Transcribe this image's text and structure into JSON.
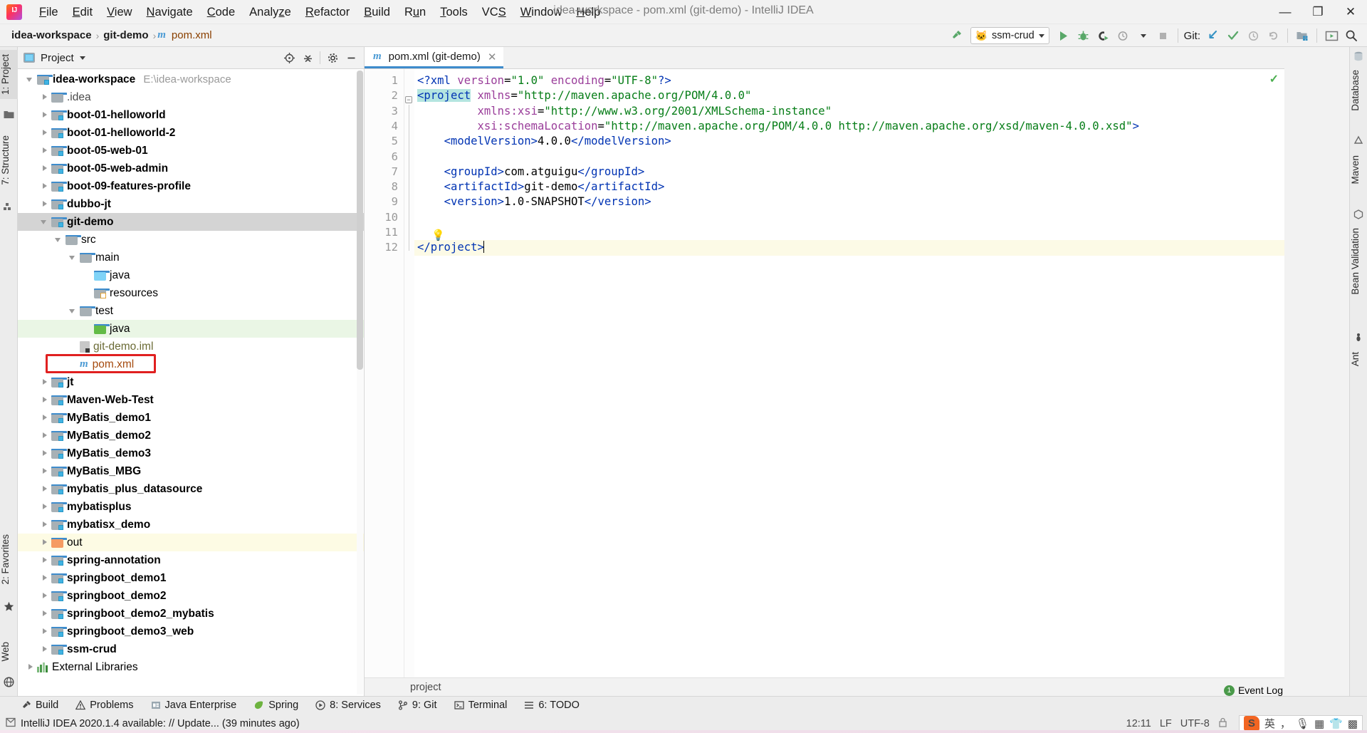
{
  "window": {
    "title": "idea-workspace - pom.xml (git-demo) - IntelliJ IDEA",
    "minimize": "—",
    "maximize": "❐",
    "close": "✕",
    "logo_text": "IJ"
  },
  "menu": [
    {
      "label": "File",
      "mnemonic": "F"
    },
    {
      "label": "Edit",
      "mnemonic": "E"
    },
    {
      "label": "View",
      "mnemonic": "V"
    },
    {
      "label": "Navigate",
      "mnemonic": "N"
    },
    {
      "label": "Code",
      "mnemonic": "C"
    },
    {
      "label": "Analyze",
      "mnemonic": "z"
    },
    {
      "label": "Refactor",
      "mnemonic": "R"
    },
    {
      "label": "Build",
      "mnemonic": "B"
    },
    {
      "label": "Run",
      "mnemonic": "u"
    },
    {
      "label": "Tools",
      "mnemonic": "T"
    },
    {
      "label": "VCS",
      "mnemonic": "S"
    },
    {
      "label": "Window",
      "mnemonic": "W"
    },
    {
      "label": "Help",
      "mnemonic": "H"
    }
  ],
  "navbar": {
    "crumbs": [
      "idea-workspace",
      "git-demo",
      "pom.xml"
    ],
    "separator": "›",
    "run_config": "ssm-crud",
    "git_label": "Git:",
    "icons": {
      "build": "hammer-icon",
      "run": "run-icon",
      "debug": "debug-icon",
      "run_coverage": "run-with-coverage-icon",
      "profiler": "profiler-icon",
      "stop": "stop-icon",
      "update_project": "git-update-icon",
      "commit": "git-commit-icon",
      "history": "git-history-icon",
      "rollback": "git-rollback-icon",
      "project_structure": "project-structure-icon",
      "presentation": "presentation-icon",
      "search": "search-icon"
    }
  },
  "left_strip": [
    {
      "label": "1: Project",
      "selected": true
    },
    {
      "label": "7: Structure",
      "selected": false
    },
    {
      "label": "2: Favorites",
      "selected": false
    },
    {
      "label": "Web",
      "selected": false
    }
  ],
  "right_strip": [
    {
      "label": "Database"
    },
    {
      "label": "Maven"
    },
    {
      "label": "Bean Validation"
    },
    {
      "label": "Ant"
    }
  ],
  "project_panel": {
    "title": "Project",
    "dropdown_caret": "▾",
    "icons": [
      "locate-icon",
      "collapse-all-icon",
      "settings-gear-icon",
      "hide-icon"
    ],
    "tree": [
      {
        "depth": 0,
        "label": "idea-workspace",
        "hint": "E:\\idea-workspace",
        "arrow": "down",
        "icon": "module-folder",
        "bold": true
      },
      {
        "depth": 1,
        "label": ".idea",
        "arrow": "right",
        "icon": "folder-plain",
        "bold": false,
        "dim": true
      },
      {
        "depth": 1,
        "label": "boot-01-helloworld",
        "arrow": "right",
        "icon": "module-folder",
        "bold": true
      },
      {
        "depth": 1,
        "label": "boot-01-helloworld-2",
        "arrow": "right",
        "icon": "module-folder",
        "bold": true
      },
      {
        "depth": 1,
        "label": "boot-05-web-01",
        "arrow": "right",
        "icon": "module-folder",
        "bold": true
      },
      {
        "depth": 1,
        "label": "boot-05-web-admin",
        "arrow": "right",
        "icon": "module-folder",
        "bold": true
      },
      {
        "depth": 1,
        "label": "boot-09-features-profile",
        "arrow": "right",
        "icon": "module-folder",
        "bold": true
      },
      {
        "depth": 1,
        "label": "dubbo-jt",
        "arrow": "right",
        "icon": "module-folder",
        "bold": true
      },
      {
        "depth": 1,
        "label": "git-demo",
        "arrow": "down",
        "icon": "module-folder",
        "bold": true,
        "selected": true
      },
      {
        "depth": 2,
        "label": "src",
        "arrow": "down",
        "icon": "folder-plain",
        "bold": false
      },
      {
        "depth": 3,
        "label": "main",
        "arrow": "down",
        "icon": "folder-plain",
        "bold": false
      },
      {
        "depth": 4,
        "label": "java",
        "arrow": "none",
        "icon": "folder-blue",
        "bold": false
      },
      {
        "depth": 4,
        "label": "resources",
        "arrow": "none",
        "icon": "folder-resources",
        "bold": false
      },
      {
        "depth": 3,
        "label": "test",
        "arrow": "down",
        "icon": "folder-plain",
        "bold": false
      },
      {
        "depth": 4,
        "label": "java",
        "arrow": "none",
        "icon": "folder-green",
        "bold": false,
        "rowbg": "green"
      },
      {
        "depth": 3,
        "label": "git-demo.iml",
        "arrow": "none",
        "icon": "iml-file",
        "bold": false,
        "olive": true
      },
      {
        "depth": 3,
        "label": "pom.xml",
        "arrow": "none",
        "icon": "maven-m",
        "bold": false,
        "brown": true,
        "annotated": true
      },
      {
        "depth": 1,
        "label": "jt",
        "arrow": "right",
        "icon": "module-folder",
        "bold": true
      },
      {
        "depth": 1,
        "label": "Maven-Web-Test",
        "arrow": "right",
        "icon": "module-folder",
        "bold": true
      },
      {
        "depth": 1,
        "label": "MyBatis_demo1",
        "arrow": "right",
        "icon": "module-folder",
        "bold": true
      },
      {
        "depth": 1,
        "label": "MyBatis_demo2",
        "arrow": "right",
        "icon": "module-folder",
        "bold": true
      },
      {
        "depth": 1,
        "label": "MyBatis_demo3",
        "arrow": "right",
        "icon": "module-folder",
        "bold": true
      },
      {
        "depth": 1,
        "label": "MyBatis_MBG",
        "arrow": "right",
        "icon": "module-folder",
        "bold": true
      },
      {
        "depth": 1,
        "label": "mybatis_plus_datasource",
        "arrow": "right",
        "icon": "module-folder",
        "bold": true
      },
      {
        "depth": 1,
        "label": "mybatisplus",
        "arrow": "right",
        "icon": "module-folder",
        "bold": true
      },
      {
        "depth": 1,
        "label": "mybatisx_demo",
        "arrow": "right",
        "icon": "module-folder",
        "bold": true
      },
      {
        "depth": 1,
        "label": "out",
        "arrow": "right",
        "icon": "folder-orange",
        "bold": false,
        "rowbg": "yellow"
      },
      {
        "depth": 1,
        "label": "spring-annotation",
        "arrow": "right",
        "icon": "module-folder",
        "bold": true
      },
      {
        "depth": 1,
        "label": "springboot_demo1",
        "arrow": "right",
        "icon": "module-folder",
        "bold": true
      },
      {
        "depth": 1,
        "label": "springboot_demo2",
        "arrow": "right",
        "icon": "module-folder",
        "bold": true
      },
      {
        "depth": 1,
        "label": "springboot_demo2_mybatis",
        "arrow": "right",
        "icon": "module-folder",
        "bold": true
      },
      {
        "depth": 1,
        "label": "springboot_demo3_web",
        "arrow": "right",
        "icon": "module-folder",
        "bold": true
      },
      {
        "depth": 1,
        "label": "ssm-crud",
        "arrow": "right",
        "icon": "module-folder",
        "bold": true
      },
      {
        "depth": 0,
        "label": "External Libraries",
        "arrow": "right",
        "icon": "external-libraries",
        "bold": false
      }
    ]
  },
  "editor": {
    "tab": {
      "label": "pom.xml (git-demo)",
      "close": "✕",
      "icon": "maven-m"
    },
    "breadcrumb": "project",
    "lines": [
      {
        "n": 1,
        "segments": [
          {
            "t": "<?xml ",
            "c": "tg"
          },
          {
            "t": "version",
            "c": "at"
          },
          {
            "t": "=",
            "c": "txt"
          },
          {
            "t": "\"1.0\"",
            "c": "st"
          },
          {
            "t": " ",
            "c": "txt"
          },
          {
            "t": "encoding",
            "c": "at"
          },
          {
            "t": "=",
            "c": "txt"
          },
          {
            "t": "\"UTF-8\"",
            "c": "st"
          },
          {
            "t": "?>",
            "c": "tg"
          }
        ]
      },
      {
        "n": 2,
        "segments": [
          {
            "t": "<project",
            "c": "tg sel"
          },
          {
            "t": " ",
            "c": "txt"
          },
          {
            "t": "xmlns",
            "c": "at"
          },
          {
            "t": "=",
            "c": "txt"
          },
          {
            "t": "\"http://maven.apache.org/POM/4.0.0\"",
            "c": "st"
          }
        ]
      },
      {
        "n": 3,
        "segments": [
          {
            "t": "         ",
            "c": "txt"
          },
          {
            "t": "xmlns:xsi",
            "c": "at"
          },
          {
            "t": "=",
            "c": "txt"
          },
          {
            "t": "\"http://www.w3.org/2001/XMLSchema-instance\"",
            "c": "st"
          }
        ]
      },
      {
        "n": 4,
        "segments": [
          {
            "t": "         ",
            "c": "txt"
          },
          {
            "t": "xsi:schemaLocation",
            "c": "at"
          },
          {
            "t": "=",
            "c": "txt"
          },
          {
            "t": "\"http://maven.apache.org/POM/4.0.0 http://maven.apache.org/xsd/maven-4.0.0.xsd\"",
            "c": "st"
          },
          {
            "t": ">",
            "c": "tg"
          }
        ]
      },
      {
        "n": 5,
        "segments": [
          {
            "t": "    ",
            "c": "txt"
          },
          {
            "t": "<modelVersion>",
            "c": "tg"
          },
          {
            "t": "4.0.0",
            "c": "txt"
          },
          {
            "t": "</modelVersion>",
            "c": "tg"
          }
        ]
      },
      {
        "n": 6,
        "segments": []
      },
      {
        "n": 7,
        "segments": [
          {
            "t": "    ",
            "c": "txt"
          },
          {
            "t": "<groupId>",
            "c": "tg"
          },
          {
            "t": "com.atguigu",
            "c": "txt"
          },
          {
            "t": "</groupId>",
            "c": "tg"
          }
        ]
      },
      {
        "n": 8,
        "segments": [
          {
            "t": "    ",
            "c": "txt"
          },
          {
            "t": "<artifactId>",
            "c": "tg"
          },
          {
            "t": "git-demo",
            "c": "txt"
          },
          {
            "t": "</artifactId>",
            "c": "tg"
          }
        ]
      },
      {
        "n": 9,
        "segments": [
          {
            "t": "    ",
            "c": "txt"
          },
          {
            "t": "<version>",
            "c": "tg"
          },
          {
            "t": "1.0-SNAPSHOT",
            "c": "txt"
          },
          {
            "t": "</version>",
            "c": "tg"
          }
        ]
      },
      {
        "n": 10,
        "segments": []
      },
      {
        "n": 11,
        "segments": []
      },
      {
        "n": 12,
        "segments": [
          {
            "t": "</project>",
            "c": "tg"
          }
        ],
        "highlight": true,
        "caret": true
      }
    ],
    "bulb_icon": "intention-bulb-icon",
    "inspection_status": "✓"
  },
  "bottom_tabs": [
    {
      "label": "Build",
      "icon": "build-hammer-icon",
      "mnemonic": ""
    },
    {
      "label": "Problems",
      "icon": "problems-warning-icon",
      "mnemonic": ""
    },
    {
      "label": "Java Enterprise",
      "icon": "java-enterprise-icon",
      "mnemonic": ""
    },
    {
      "label": "Spring",
      "icon": "spring-leaf-icon",
      "mnemonic": ""
    },
    {
      "label": "8: Services",
      "icon": "services-icon",
      "mnemonic": "8"
    },
    {
      "label": "9: Git",
      "icon": "git-branch-icon",
      "mnemonic": "9"
    },
    {
      "label": "Terminal",
      "icon": "terminal-icon",
      "mnemonic": ""
    },
    {
      "label": "6: TODO",
      "icon": "todo-icon",
      "mnemonic": "6"
    }
  ],
  "statusbar": {
    "message": "IntelliJ IDEA 2020.1.4 available: // Update... (39 minutes ago)",
    "message_icon": "notification-icon",
    "event_log": "Event Log",
    "event_log_count": "1",
    "caret_position": "12:11",
    "line_separator": "LF",
    "encoding": "UTF-8",
    "tray": {
      "sogou": "S",
      "lang": "英",
      "items": [
        "comma-icon",
        "mic-icon",
        "keyboard-icon",
        "skin-icon",
        "apps-icon"
      ]
    }
  },
  "colors": {
    "accent_blue": "#3e8ccc",
    "tag_blue": "#0033b3",
    "string_green": "#067d17",
    "attr_purple": "#9a3d9a",
    "selection_teal": "#b4e5e0",
    "annotation_red": "#e02020",
    "green_folder": "#62bb46",
    "orange_folder": "#f59b63",
    "blue_folder": "#7fd3f7"
  }
}
